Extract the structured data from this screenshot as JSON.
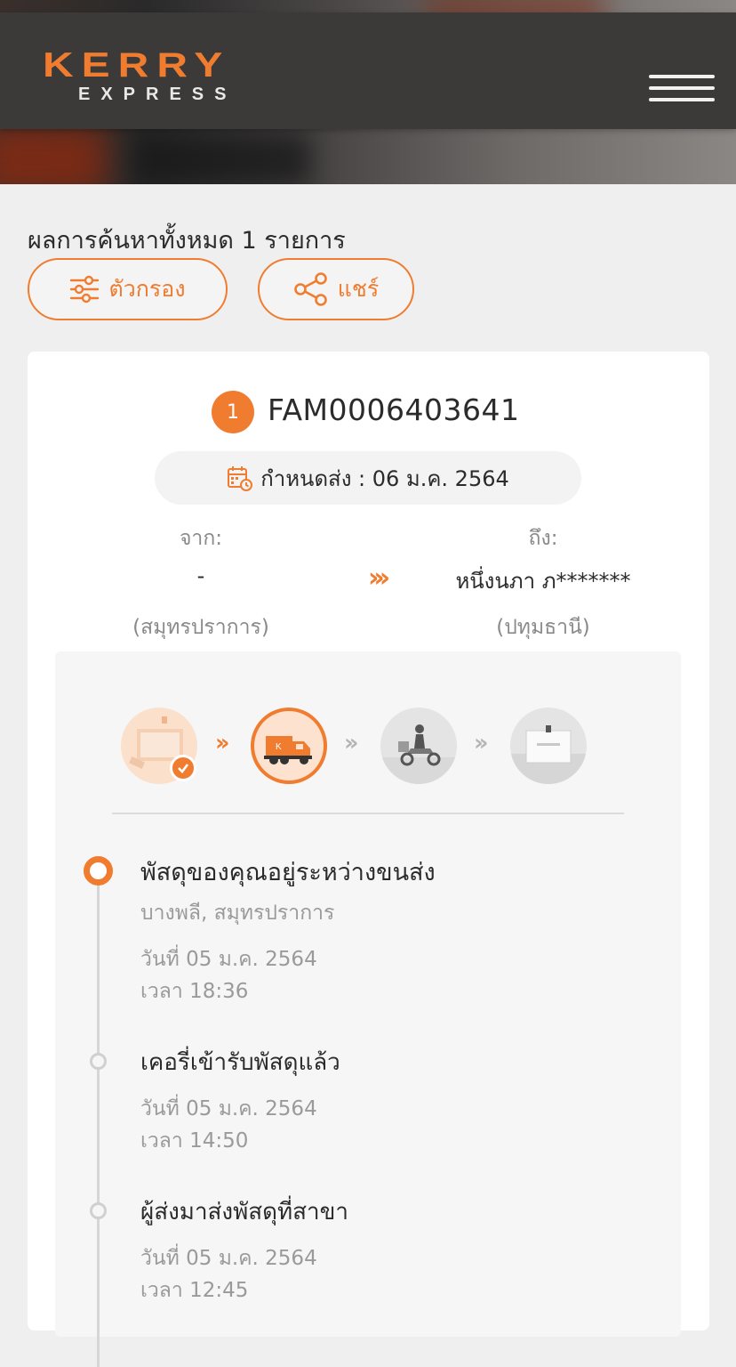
{
  "header": {
    "logo_main": "KERRY",
    "logo_sub": "EXPRESS",
    "menu_icon": "hamburger-menu-icon"
  },
  "results": {
    "title": "ผลการค้นหาทั้งหมด 1 รายการ",
    "filter_label": "ตัวกรอง",
    "share_label": "แชร์"
  },
  "shipment": {
    "index": "1",
    "tracking_number": "FAM0006403641",
    "due_label": "กำหนดส่ง : 06 ม.ค. 2564",
    "from_label": "จาก:",
    "from_name": "-",
    "from_province": "(สมุทรปราการ)",
    "to_label": "ถึง:",
    "to_name": "หนึ่งนภา ภ*******",
    "to_province": "(ปทุมธานี)",
    "progress_steps": [
      {
        "name": "parcel-received",
        "state": "done"
      },
      {
        "name": "in-transit",
        "state": "current"
      },
      {
        "name": "out-for-delivery",
        "state": "pending"
      },
      {
        "name": "delivered",
        "state": "pending"
      }
    ],
    "events": [
      {
        "title": "พัสดุของคุณอยู่ระหว่างขนส่ง",
        "location": "บางพลี, สมุทรปราการ",
        "date": "วันที่ 05 ม.ค. 2564",
        "time": "เวลา 18:36"
      },
      {
        "title": "เคอรี่เข้ารับพัสดุแล้ว",
        "date": "วันที่ 05 ม.ค. 2564",
        "time": "เวลา 14:50"
      },
      {
        "title": "ผู้ส่งมาส่งพัสดุที่สาขา",
        "date": "วันที่ 05 ม.ค. 2564",
        "time": "เวลา 12:45"
      }
    ]
  },
  "colors": {
    "accent": "#f07c2f",
    "navbar": "#3b3a39",
    "muted_text": "#9a9a9a"
  }
}
